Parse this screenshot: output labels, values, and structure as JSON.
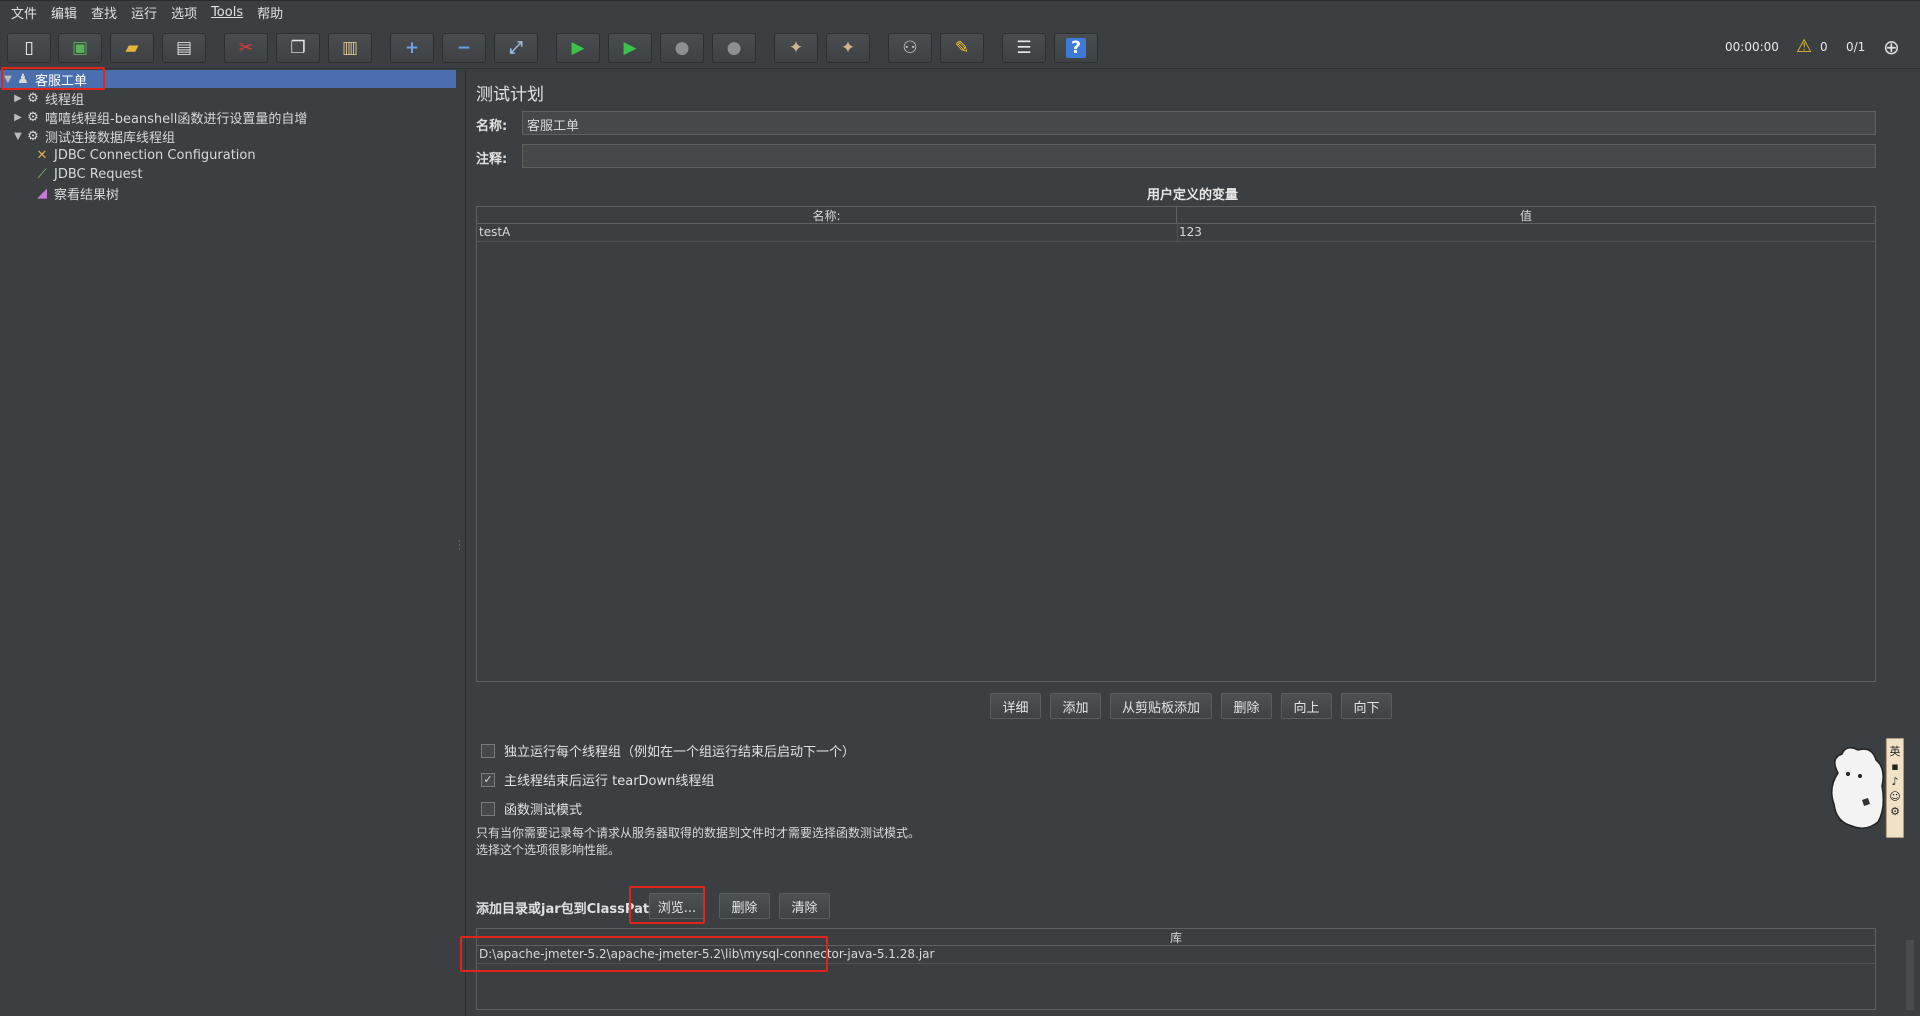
{
  "menu": [
    "文件",
    "编辑",
    "查找",
    "运行",
    "选项",
    "Tools",
    "帮助"
  ],
  "toolbar": {
    "buttons": [
      {
        "name": "new-icon",
        "glyph": "▯"
      },
      {
        "name": "templates-icon",
        "glyph": "▣"
      },
      {
        "name": "open-icon",
        "glyph": "▰"
      },
      {
        "name": "save-icon",
        "glyph": "▤"
      },
      {
        "name": "cut-icon",
        "glyph": "✂"
      },
      {
        "name": "copy-icon",
        "glyph": "❐"
      },
      {
        "name": "paste-icon",
        "glyph": "▥"
      },
      {
        "name": "expand-icon",
        "glyph": "+"
      },
      {
        "name": "collapse-icon",
        "glyph": "−"
      },
      {
        "name": "toggle-icon",
        "glyph": "⤢"
      },
      {
        "name": "start-icon",
        "glyph": "▶"
      },
      {
        "name": "start-no-pause-icon",
        "glyph": "▶"
      },
      {
        "name": "stop-icon",
        "glyph": "●"
      },
      {
        "name": "shutdown-icon",
        "glyph": "●"
      },
      {
        "name": "clear-icon",
        "glyph": "✦"
      },
      {
        "name": "clear-all-icon",
        "glyph": "✦"
      },
      {
        "name": "search-icon",
        "glyph": "⚇"
      },
      {
        "name": "reset-search-icon",
        "glyph": "✎"
      },
      {
        "name": "function-helper-icon",
        "glyph": "☰"
      },
      {
        "name": "help-icon",
        "glyph": "?"
      }
    ],
    "timer": "00:00:00",
    "warnings": "0",
    "threads": "0/1"
  },
  "tree": {
    "items": [
      {
        "label": "客服工单",
        "icon": "test-plan-icon",
        "selected": true
      },
      {
        "label": "线程组",
        "icon": "gear-icon"
      },
      {
        "label": "嘻嘻线程组-beanshell函数进行设置量的自增",
        "icon": "gear-icon"
      },
      {
        "label": "测试连接数据库线程组",
        "icon": "gear-icon"
      },
      {
        "label": "JDBC Connection Configuration",
        "icon": "wrench-icon"
      },
      {
        "label": "JDBC Request",
        "icon": "sampler-icon"
      },
      {
        "label": "察看结果树",
        "icon": "chart-icon"
      }
    ]
  },
  "panel": {
    "title": "测试计划",
    "name_label": "名称:",
    "name_value": "客服工单",
    "comment_label": "注释:",
    "comment_value": "",
    "vars_title": "用户定义的变量",
    "vars_columns": [
      "名称:",
      "值"
    ],
    "vars_rows": [
      [
        "testA",
        "123"
      ]
    ],
    "buttons": [
      "详细",
      "添加",
      "从剪贴板添加",
      "删除",
      "向上",
      "向下"
    ],
    "checkboxes": [
      {
        "label": "独立运行每个线程组（例如在一个组运行结束后启动下一个）",
        "checked": false
      },
      {
        "label": "主线程结束后运行 tearDown线程组",
        "checked": true
      },
      {
        "label": "函数测试模式",
        "checked": false
      }
    ],
    "note_line1": "只有当你需要记录每个请求从服务器取得的数据到文件时才需要选择函数测试模式。",
    "note_line2": "选择这个选项很影响性能。",
    "classpath_label": "添加目录或jar包到ClassPath",
    "browse_label": "浏览...",
    "delete_label": "删除",
    "clear_label": "清除",
    "lib_header": "库",
    "lib_rows": [
      "D:\\apache-jmeter-5.2\\apache-jmeter-5.2\\lib\\mysql-connector-java-5.1.28.jar"
    ]
  },
  "mascot_text": "英 ▪ ♪ ☺ ⚙"
}
